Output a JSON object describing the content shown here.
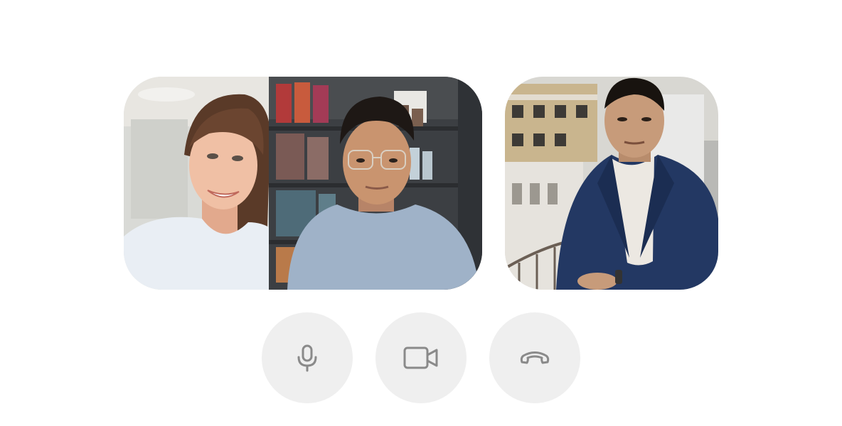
{
  "call": {
    "participants": [
      {
        "id": "participant-woman"
      },
      {
        "id": "participant-glasses"
      },
      {
        "id": "participant-suit"
      }
    ]
  },
  "controls": [
    {
      "icon": "microphone-icon",
      "action": "mute"
    },
    {
      "icon": "video-camera-icon",
      "action": "toggle-video"
    },
    {
      "icon": "hang-up-icon",
      "action": "end-call"
    }
  ],
  "colors": {
    "button_bg": "#efefef",
    "icon_stroke": "#8a8a8a"
  }
}
